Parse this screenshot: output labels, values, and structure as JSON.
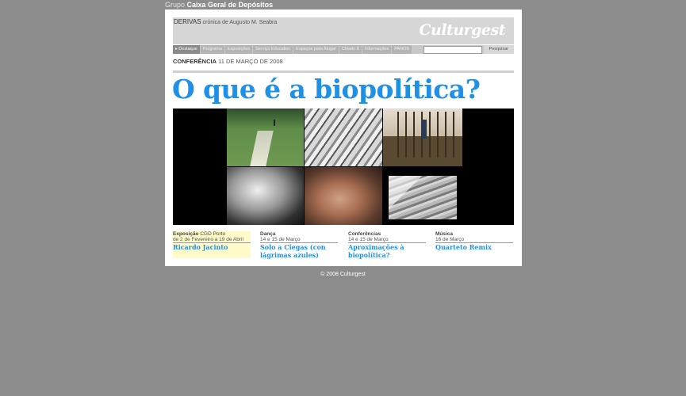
{
  "group": {
    "prefix": "Grupo",
    "name": "Caixa Geral de Depósitos"
  },
  "header": {
    "section_name": "DERIVAS",
    "section_desc": "crónica de Augusto M. Seabra",
    "logo": "Culturgest"
  },
  "nav": {
    "items": [
      {
        "label": "▸ Destaque",
        "active": true
      },
      {
        "label": "Programa"
      },
      {
        "label": "Exposições"
      },
      {
        "label": "Serviço Educativo"
      },
      {
        "label": "Espaços para Alugar"
      },
      {
        "label": "Chiado 8"
      },
      {
        "label": "Informações"
      },
      {
        "label": "PANOS"
      }
    ],
    "search_value": "",
    "search_button": "Pesquisar"
  },
  "event": {
    "category": "CONFERÊNCIA",
    "date": "11 DE MARÇO DE 2008"
  },
  "headline": "O que é a biopolítica?",
  "columns": [
    {
      "category": "Exposição",
      "venue": "CGD Porto",
      "date": "de 2 de Fevereiro a 19 de Abril",
      "title": "Ricardo Jacinto"
    },
    {
      "category": "Dança",
      "venue": "",
      "date": "14 e 15 de Março",
      "title": "Solo a Ciegas (con lágrimas azules)"
    },
    {
      "category": "Conferências",
      "venue": "",
      "date": "14 e 15 de Março",
      "title": "Aproximações à biopolítica?"
    },
    {
      "category": "Música",
      "venue": "",
      "date": "16 de Março",
      "title": "Quarteto Remix"
    }
  ],
  "footer": "© 2008 Culturgest",
  "colors": {
    "accent": "#1e90e6",
    "background": "#8c8c8c",
    "highlight": "#fffbc8"
  }
}
